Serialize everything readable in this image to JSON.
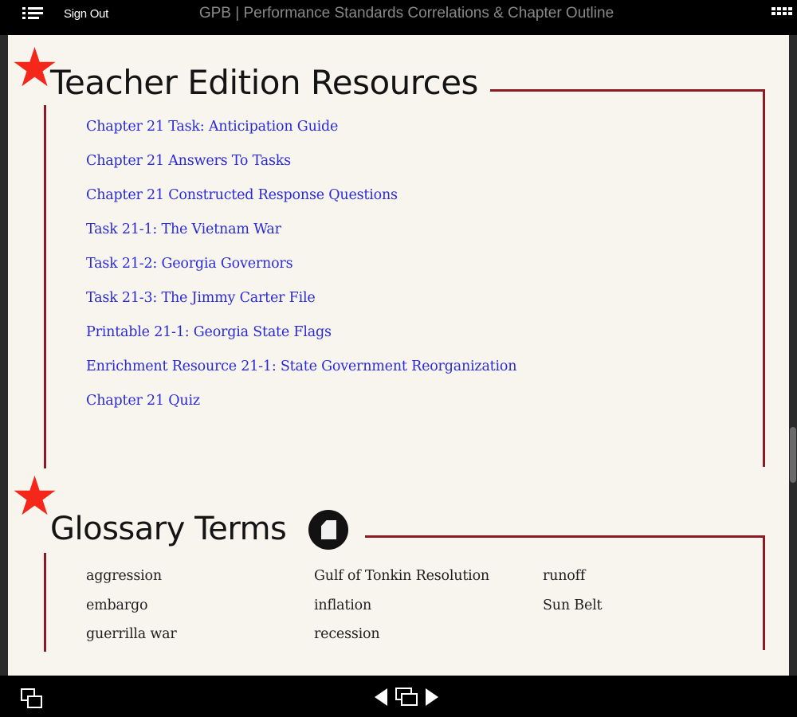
{
  "topbar": {
    "menu_icon": "list-menu-icon",
    "sign_out_label": "Sign Out",
    "title": "GPB | Performance Standards Correlations & Chapter Outline",
    "grid_icon": "grid-view-icon"
  },
  "colors": {
    "accent_red_line": "#8b1a24",
    "star": "#f5271b",
    "link": "#2b2bd6",
    "page_background": "#f8f5ef"
  },
  "teacher_section": {
    "star_icon": "star-icon",
    "heading": "Teacher Edition Resources",
    "links": [
      "Chapter 21 Task: Anticipation Guide",
      "Chapter 21 Answers To Tasks",
      "Chapter 21 Constructed Response Questions",
      "Task 21-1: The Vietnam War",
      "Task 21-2: Georgia Governors",
      "Task 21-3: The Jimmy Carter File",
      "Printable 21-1: Georgia State Flags",
      "Enrichment Resource 21-1: State Government Reorganization",
      "Chapter 21 Quiz"
    ]
  },
  "glossary_section": {
    "star_icon": "star-icon",
    "heading": "Glossary Terms",
    "doc_icon": "document-icon",
    "columns": [
      [
        "aggression",
        "embargo",
        "guerrilla war"
      ],
      [
        "Gulf of Tonkin Resolution",
        "inflation",
        "recession"
      ],
      [
        "runoff",
        "Sun Belt"
      ]
    ]
  },
  "bottombar": {
    "workspace_icon": "window-overlap-icon",
    "prev_icon": "previous-page-icon",
    "pages_icon": "pages-icon",
    "next_icon": "next-page-icon"
  }
}
